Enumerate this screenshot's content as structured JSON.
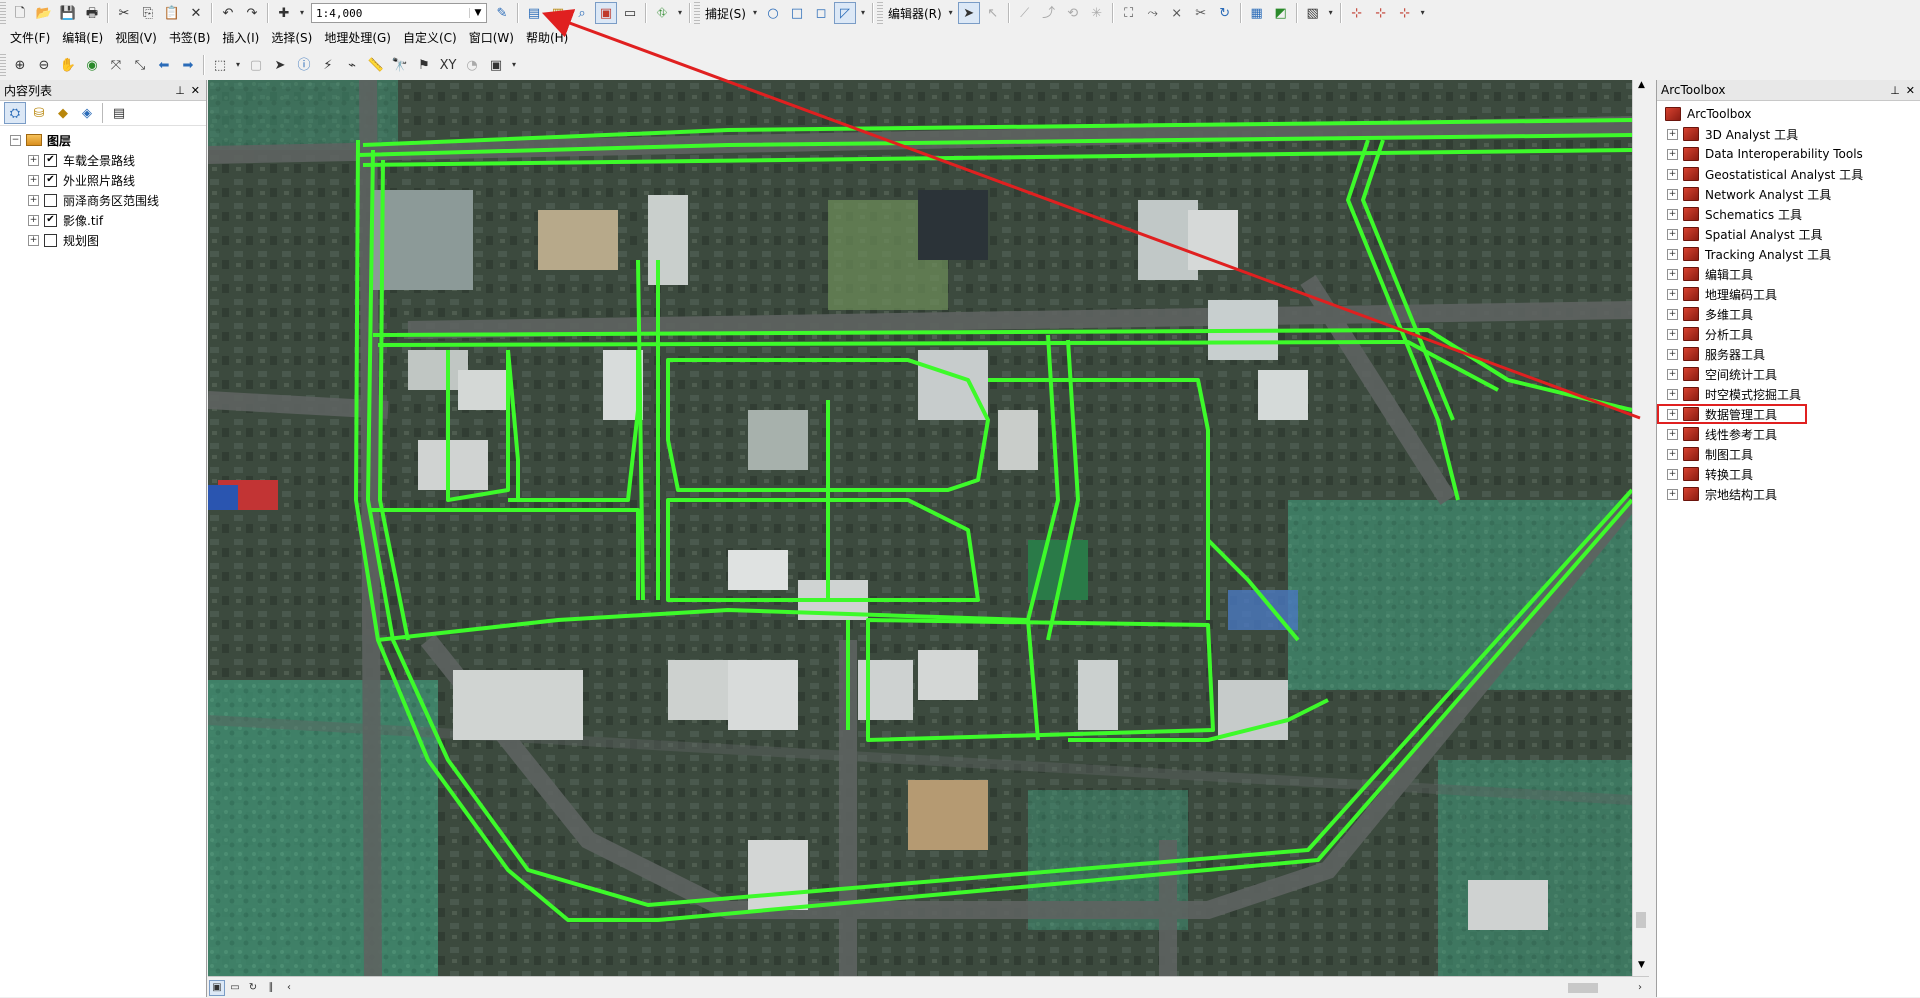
{
  "toolbar_standard": {
    "scale_value": "1:4,000",
    "snapping_label": "捕捉(S)",
    "editor_label": "编辑器(R)"
  },
  "menubar": {
    "items": [
      "文件(F)",
      "编辑(E)",
      "视图(V)",
      "书签(B)",
      "插入(I)",
      "选择(S)",
      "地理处理(G)",
      "自定义(C)",
      "窗口(W)",
      "帮助(H)"
    ]
  },
  "toc": {
    "title": "内容列表",
    "root_label": "图层",
    "layers": [
      {
        "label": "车载全景路线",
        "checked": true
      },
      {
        "label": "外业照片路线",
        "checked": true
      },
      {
        "label": "丽泽商务区范围线",
        "checked": false
      },
      {
        "label": "影像.tif",
        "checked": true
      },
      {
        "label": "规划图",
        "checked": false
      }
    ]
  },
  "toolbox": {
    "title": "ArcToolbox",
    "root_label": "ArcToolbox",
    "items": [
      "3D Analyst 工具",
      "Data Interoperability Tools",
      "Geostatistical Analyst 工具",
      "Network Analyst 工具",
      "Schematics 工具",
      "Spatial Analyst 工具",
      "Tracking Analyst 工具",
      "编辑工具",
      "地理编码工具",
      "多维工具",
      "分析工具",
      "服务器工具",
      "空间统计工具",
      "时空模式挖掘工具",
      "数据管理工具",
      "线性参考工具",
      "制图工具",
      "转换工具",
      "宗地结构工具"
    ],
    "highlighted_item": "数据管理工具"
  },
  "colors": {
    "route_green": "#3dfa2a",
    "annotation_red": "#e02020",
    "toolbox_icon_red": "#c0392b"
  },
  "icons": {
    "toolbar_active": "arctoolbox-window-icon",
    "arrow_target": "arctoolbox-button"
  }
}
